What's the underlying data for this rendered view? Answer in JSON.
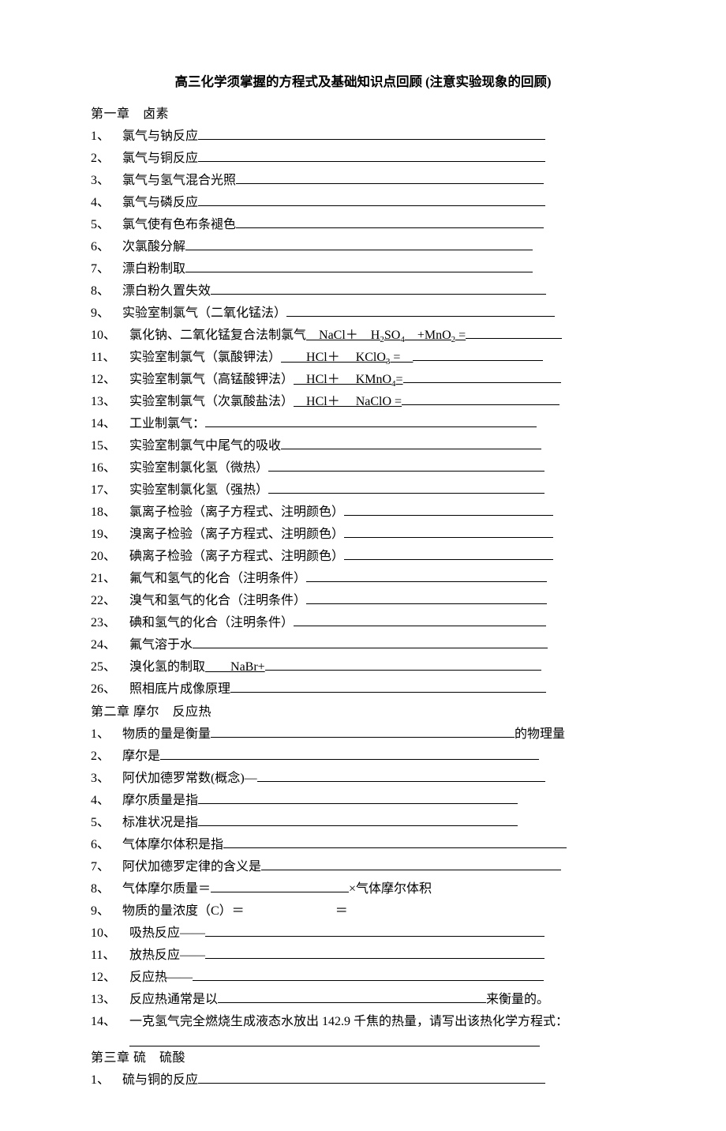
{
  "title": "高三化学须掌握的方程式及基础知识点回顾  (注意实验现象的回顾)",
  "chapter1": {
    "heading": "第一章　卤素",
    "items": [
      {
        "num": "1、",
        "label": "氯气与钠反应",
        "blank": 440
      },
      {
        "num": "2、",
        "label": "氯气与铜反应",
        "blank": 440
      },
      {
        "num": "3、",
        "label": "氯气与氢气混合光照",
        "blank": 390
      },
      {
        "num": "4、",
        "label": "氯气与磷反应",
        "blank": 440
      },
      {
        "num": "5、",
        "label": "氯气使有色布条褪色",
        "blank": 390
      },
      {
        "num": "6、",
        "label": "次氯酸分解",
        "blank": 440
      },
      {
        "num": "7、",
        "label": "漂白粉制取",
        "blank": 440
      },
      {
        "num": "8、",
        "label": "漂白粉久置失效",
        "blank": 425
      },
      {
        "num": "9、",
        "label": "实验室制氯气（二氧化锰法）",
        "blank": 340
      },
      {
        "num": "10、",
        "wide": true,
        "label": "氯化钠、二氧化锰复合法制氯气",
        "formula_ul": "　NaCl＋　H₂SO₄　+MnO₂ =",
        "blank": 122
      },
      {
        "num": "11、",
        "wide": true,
        "label": "实验室制氯气（氯酸钾法）",
        "formula_ul": "　　HCl＋　 KClO₃ =　",
        "blank": 165
      },
      {
        "num": "12、",
        "wide": true,
        "label": "实验室制氯气（高锰酸钾法）",
        "formula_ul": "　HCl＋　 KMnO₄=",
        "blank": 200
      },
      {
        "num": "13、",
        "wide": true,
        "label": "实验室制氯气（次氯酸盐法）",
        "formula_ul": "　HCl＋　 NaClO =",
        "blank": 200
      },
      {
        "num": "14、",
        "wide": true,
        "label": "工业制氯气：",
        "blank": 420
      },
      {
        "num": "15、",
        "wide": true,
        "label": "实验室制氯气中尾气的吸收",
        "blank": 330
      },
      {
        "num": "16、",
        "wide": true,
        "label": "实验室制氯化氢（微热）",
        "blank": 350
      },
      {
        "num": "17、",
        "wide": true,
        "label": "实验室制氯化氢（强热）",
        "blank": 350
      },
      {
        "num": "18、",
        "wide": true,
        "label": "氯离子检验（离子方程式、注明颜色）",
        "blank": 265
      },
      {
        "num": "19、",
        "wide": true,
        "label": "溴离子检验（离子方程式、注明颜色）",
        "blank": 265
      },
      {
        "num": "20、",
        "wide": true,
        "label": "碘离子检验（离子方程式、注明颜色）",
        "blank": 265
      },
      {
        "num": "21、",
        "wide": true,
        "label": "氟气和氢气的化合（注明条件）",
        "blank": 305
      },
      {
        "num": "22、",
        "wide": true,
        "label": "溴气和氢气的化合（注明条件）",
        "blank": 305
      },
      {
        "num": "23、",
        "wide": true,
        "label": "碘和氢气的化合（注明条件）",
        "blank": 320
      },
      {
        "num": "24、",
        "wide": true,
        "label": "氟气溶于水",
        "blank": 450
      },
      {
        "num": "25、",
        "wide": true,
        "label": "溴化氢的制取",
        "formula_ul": "　　NaBr+",
        "blank": 350
      },
      {
        "num": "26、",
        "wide": true,
        "label": "照相底片成像原理",
        "blank": 400
      }
    ]
  },
  "chapter2": {
    "heading": "第二章 摩尔　反应热",
    "items": [
      {
        "num": "1、",
        "label": "物质的量是衡量",
        "blank": 385,
        "suffix": "的物理量"
      },
      {
        "num": "2、",
        "label": "摩尔是",
        "blank": 480
      },
      {
        "num": "3、",
        "label": "阿伏加德罗常数(概念)—",
        "blank": 365
      },
      {
        "num": "4、",
        "label": "摩尔质量是指",
        "blank": 405
      },
      {
        "num": "5、",
        "label": "标准状况是指",
        "blank": 405
      },
      {
        "num": "6、",
        "label": "气体摩尔体积是指",
        "blank": 435
      },
      {
        "num": "7、",
        "label": "阿伏加德罗定律的含义是",
        "blank": 380
      },
      {
        "num": "8、",
        "label": "气体摩尔质量＝",
        "blank": 175,
        "suffix": "×气体摩尔体积"
      },
      {
        "num": "9、",
        "label": "物质的量浓度（C）＝",
        "gap1": 115,
        "mid": "＝",
        "gap2": 0
      },
      {
        "num": "10、",
        "wide": true,
        "label": "吸热反应——",
        "blank": 430
      },
      {
        "num": "11、",
        "wide": true,
        "label": "放热反应——",
        "blank": 430
      },
      {
        "num": "12、",
        "wide": true,
        "label": "反应热——",
        "blank": 445
      },
      {
        "num": "13、",
        "wide": true,
        "label": "反应热通常是以",
        "blank": 340,
        "suffix": "来衡量的。"
      },
      {
        "num": "14、",
        "wide": true,
        "label": "一克氢气完全燃烧生成液态水放出 142.9 千焦的热量，请写出该热化学方程式：",
        "blank_below": 520
      }
    ]
  },
  "chapter3": {
    "heading": "第三章  硫　硫酸",
    "items": [
      {
        "num": "1、",
        "label": "硫与铜的反应",
        "blank": 440
      }
    ]
  }
}
